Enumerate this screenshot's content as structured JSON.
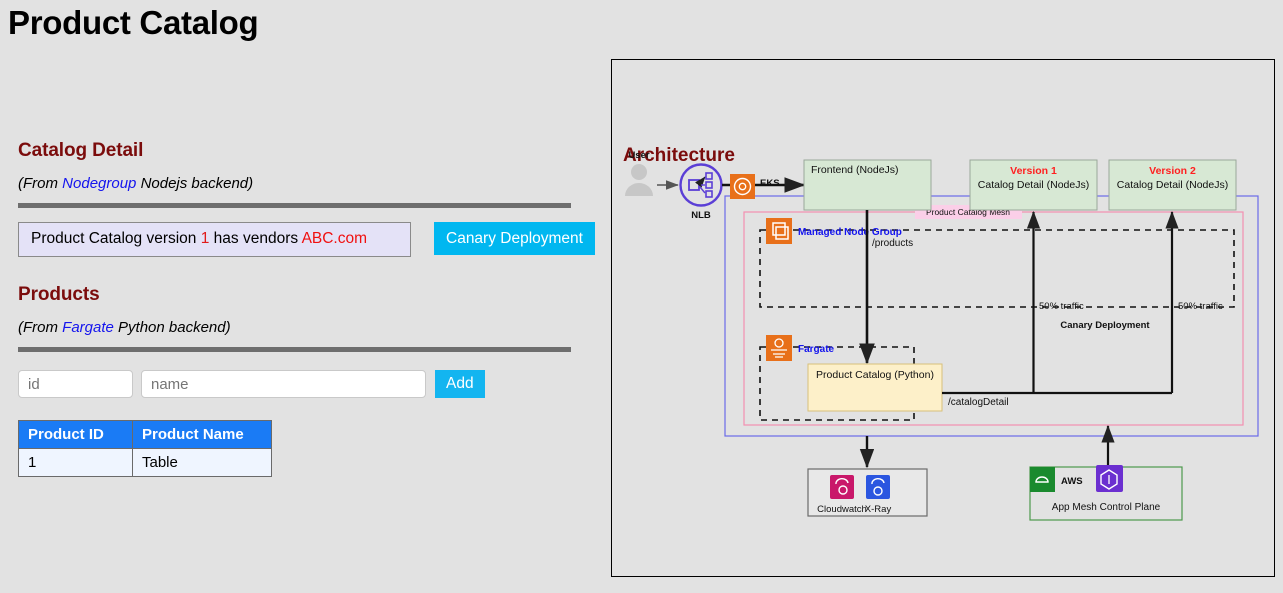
{
  "page": {
    "title": "Product Catalog"
  },
  "catalog_detail": {
    "heading": "Catalog Detail",
    "subnote_pre": "(From ",
    "subnote_link": "Nodegroup",
    "subnote_post": " Nodejs backend)",
    "message_pre": "Product Catalog version ",
    "message_version": "1",
    "message_mid": " has vendors ",
    "message_vendor": "ABC.com",
    "canary_button": "Canary Deployment"
  },
  "products": {
    "heading": "Products",
    "subnote_pre": "(From ",
    "subnote_link": "Fargate",
    "subnote_post": " Python backend)",
    "id_placeholder": "id",
    "name_placeholder": "name",
    "id_value": "",
    "name_value": "",
    "add_button": "Add",
    "columns": [
      "Product ID",
      "Product Name"
    ],
    "rows": [
      [
        "1",
        "Table"
      ]
    ]
  },
  "architecture": {
    "heading": "Architecture",
    "nodes": {
      "user": "User",
      "nlb": "NLB",
      "eks": "EKS",
      "mesh": "Product Catalog Mesh",
      "managed_node_group": "Managed Node Group",
      "frontend": "Frontend (NodeJs)",
      "version1_label": "Version 1",
      "version1_body": "Catalog Detail (NodeJs)",
      "version2_label": "Version 2",
      "version2_body": "Catalog Detail (NodeJs)",
      "fargate": "Fargate",
      "product_catalog": "Product Catalog (Python)",
      "cloudwatch": "Cloudwatch",
      "xray": "X-Ray",
      "aws": "AWS",
      "app_mesh_control_plane": "App Mesh Control Plane"
    },
    "edges": {
      "products_path": "/products",
      "catalog_detail_path": "/catalogDetail",
      "traffic_v1": "50% traffic",
      "traffic_v2": "50% traffic",
      "canary_deployment": "Canary Deployment"
    },
    "colors": {
      "eks_border": "#6a6ae8",
      "mesh_border": "#f48fb1",
      "green_box": "#d7e8d4",
      "yellow_box": "#fdf0c9",
      "orange_icon": "#e8701a",
      "red_text": "#ff2020",
      "blue_text": "#1414ee"
    }
  }
}
